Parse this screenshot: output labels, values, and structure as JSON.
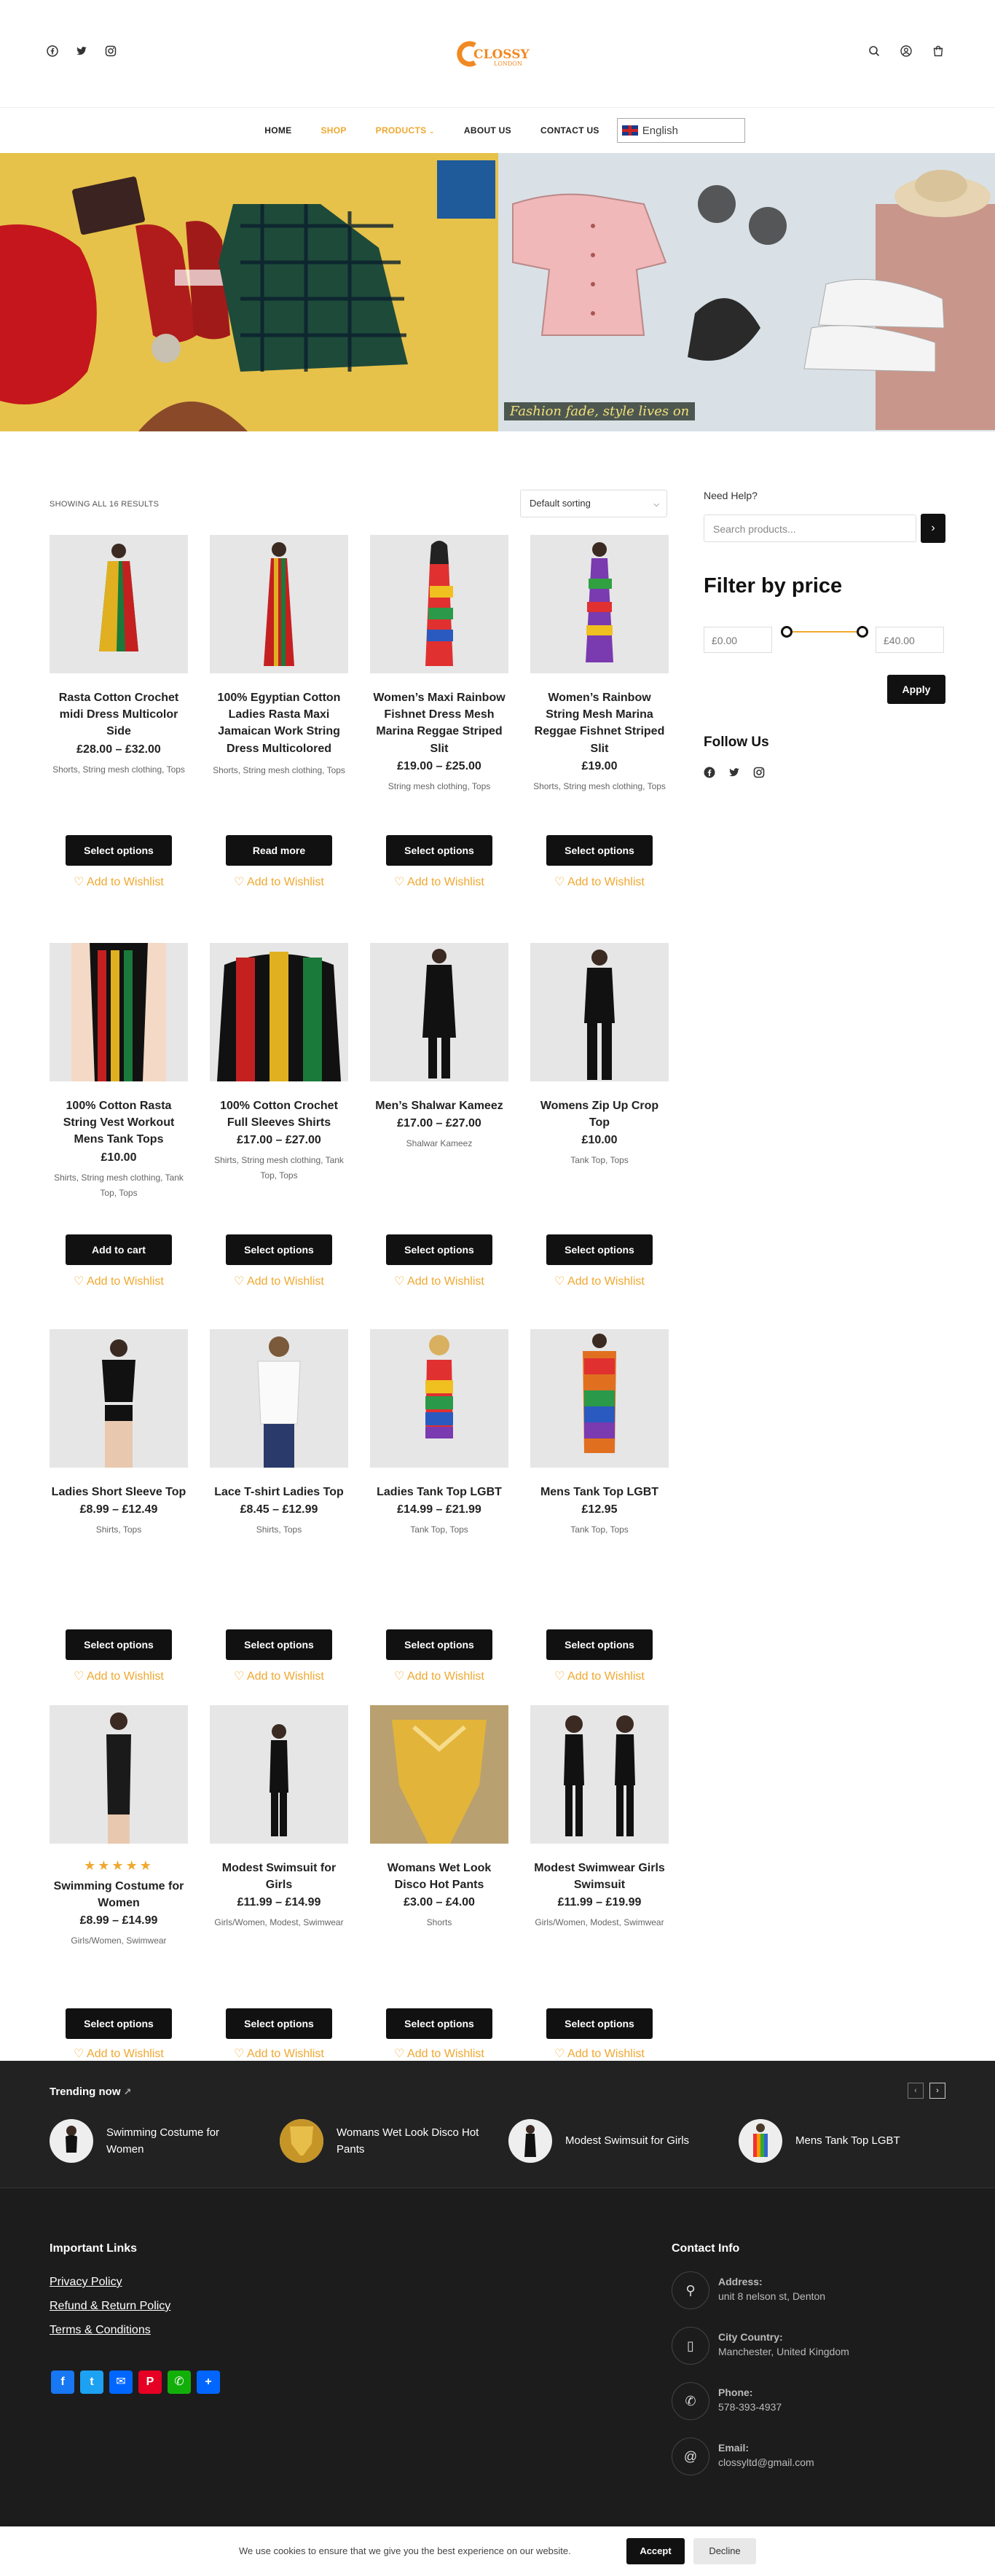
{
  "header": {
    "logo_text": "CLOSSY",
    "logo_sub": "LONDON",
    "social": [
      "facebook-icon",
      "twitter-icon",
      "instagram-icon"
    ],
    "utility_icons": [
      "search-icon",
      "user-icon",
      "cart-icon"
    ]
  },
  "nav": {
    "items": [
      {
        "label": "HOME",
        "active": false
      },
      {
        "label": "SHOP",
        "active": true
      },
      {
        "label": "PRODUCTS",
        "active": true
      },
      {
        "label": "ABOUT US",
        "active": false
      },
      {
        "label": "CONTACT US",
        "active": false
      }
    ],
    "language": "English"
  },
  "hero": {
    "caption": "Fashion fade, style lives on"
  },
  "shop": {
    "results_text": "SHOWING ALL 16 RESULTS",
    "sort_value": "Default sorting",
    "wishlist_label": "Add to Wishlist",
    "products": [
      {
        "name": "Rasta Cotton Crochet midi Dress Multicolor Side",
        "price": "£28.00 – £32.00",
        "cats": "Shorts, String mesh clothing, Tops",
        "button": "Select options"
      },
      {
        "name": "100% Egyptian Cotton Ladies Rasta Maxi Jamaican Work String Dress Multicolored",
        "price": "",
        "cats": "Shorts, String mesh clothing, Tops",
        "button": "Read more"
      },
      {
        "name": "Women’s Maxi Rainbow Fishnet Dress Mesh Marina Reggae Striped Slit",
        "price": "£19.00 – £25.00",
        "cats": "String mesh clothing, Tops",
        "button": "Select options"
      },
      {
        "name": "Women’s Rainbow String Mesh Marina Reggae Fishnet Striped Slit",
        "price": "£19.00",
        "cats": "Shorts, String mesh clothing, Tops",
        "button": "Select options"
      },
      {
        "name": "100% Cotton Rasta String Vest Workout Mens Tank Tops",
        "price": "£10.00",
        "cats": "Shirts, String mesh clothing, Tank Top, Tops",
        "button": "Add to cart"
      },
      {
        "name": "100% Cotton Crochet Full Sleeves Shirts",
        "price": "£17.00 – £27.00",
        "cats": "Shirts, String mesh clothing, Tank Top, Tops",
        "button": "Select options"
      },
      {
        "name": "Men’s Shalwar Kameez",
        "price": "£17.00 – £27.00",
        "cats": "Shalwar Kameez",
        "button": "Select options"
      },
      {
        "name": "Womens Zip Up Crop Top",
        "price": "£10.00",
        "cats": "Tank Top, Tops",
        "button": "Select options"
      },
      {
        "name": "Ladies Short Sleeve Top",
        "price": "£8.99 – £12.49",
        "cats": "Shirts, Tops",
        "button": "Select options"
      },
      {
        "name": "Lace T-shirt Ladies Top",
        "price": "£8.45 – £12.99",
        "cats": "Shirts, Tops",
        "button": "Select options"
      },
      {
        "name": "Ladies Tank Top LGBT",
        "price": "£14.99 – £21.99",
        "cats": "Tank Top, Tops",
        "button": "Select options"
      },
      {
        "name": "Mens Tank Top LGBT",
        "price": "£12.95",
        "cats": "Tank Top, Tops",
        "button": "Select options"
      },
      {
        "name": "Swimming Costume for Women",
        "price": "£8.99 – £14.99",
        "cats": "Girls/Women, Swimwear",
        "button": "Select options",
        "rating": 5
      },
      {
        "name": "Modest Swimsuit for Girls",
        "price": "£11.99 – £14.99",
        "cats": "Girls/Women, Modest, Swimwear",
        "button": "Select options"
      },
      {
        "name": "Womans Wet Look Disco Hot Pants",
        "price": "£3.00 – £4.00",
        "cats": "Shorts",
        "button": "Select options"
      },
      {
        "name": "Modest Swimwear Girls Swimsuit",
        "price": "£11.99 – £19.99",
        "cats": "Girls/Women, Modest, Swimwear",
        "button": "Select options"
      }
    ]
  },
  "sidebar": {
    "help_label": "Need Help?",
    "search_placeholder": "Search products...",
    "filter_title": "Filter by price",
    "price_min": "£0.00",
    "price_max": "£40.00",
    "apply_label": "Apply",
    "follow_title": "Follow Us",
    "social": [
      "facebook-icon",
      "twitter-icon",
      "instagram-icon"
    ]
  },
  "trending": {
    "title": "Trending now",
    "items": [
      "Swimming Costume for Women",
      "Womans Wet Look Disco Hot Pants",
      "Modest Swimsuit for Girls",
      "Mens Tank Top LGBT"
    ]
  },
  "footer": {
    "links_title": "Important Links",
    "links": [
      "Privacy Policy",
      "Refund & Return Policy",
      "Terms & Conditions"
    ],
    "share_icons": [
      "facebook-icon",
      "twitter-icon",
      "email-icon",
      "pinterest-icon",
      "whatsapp-icon",
      "share-plus-icon"
    ],
    "contact_title": "Contact Info",
    "contacts": [
      {
        "label": "Address:",
        "value": "unit 8 nelson st, Denton",
        "icon": "location-icon"
      },
      {
        "label": "City Country:",
        "value": "Manchester, United Kingdom",
        "icon": "phone-device-icon"
      },
      {
        "label": "Phone:",
        "value": "578-393-4937",
        "icon": "phone-icon"
      },
      {
        "label": "Email:",
        "value": "clossyltd@gmail.com",
        "icon": "email-at-icon"
      }
    ]
  },
  "cookie": {
    "text": "We use cookies to ensure that we give you the best experience on our website.",
    "accept": "Accept",
    "decline": "Decline"
  },
  "colors": {
    "accent": "#f0a830",
    "dark": "#111111",
    "footer_bg": "#1c1c1c",
    "trending_bg": "#222222"
  }
}
